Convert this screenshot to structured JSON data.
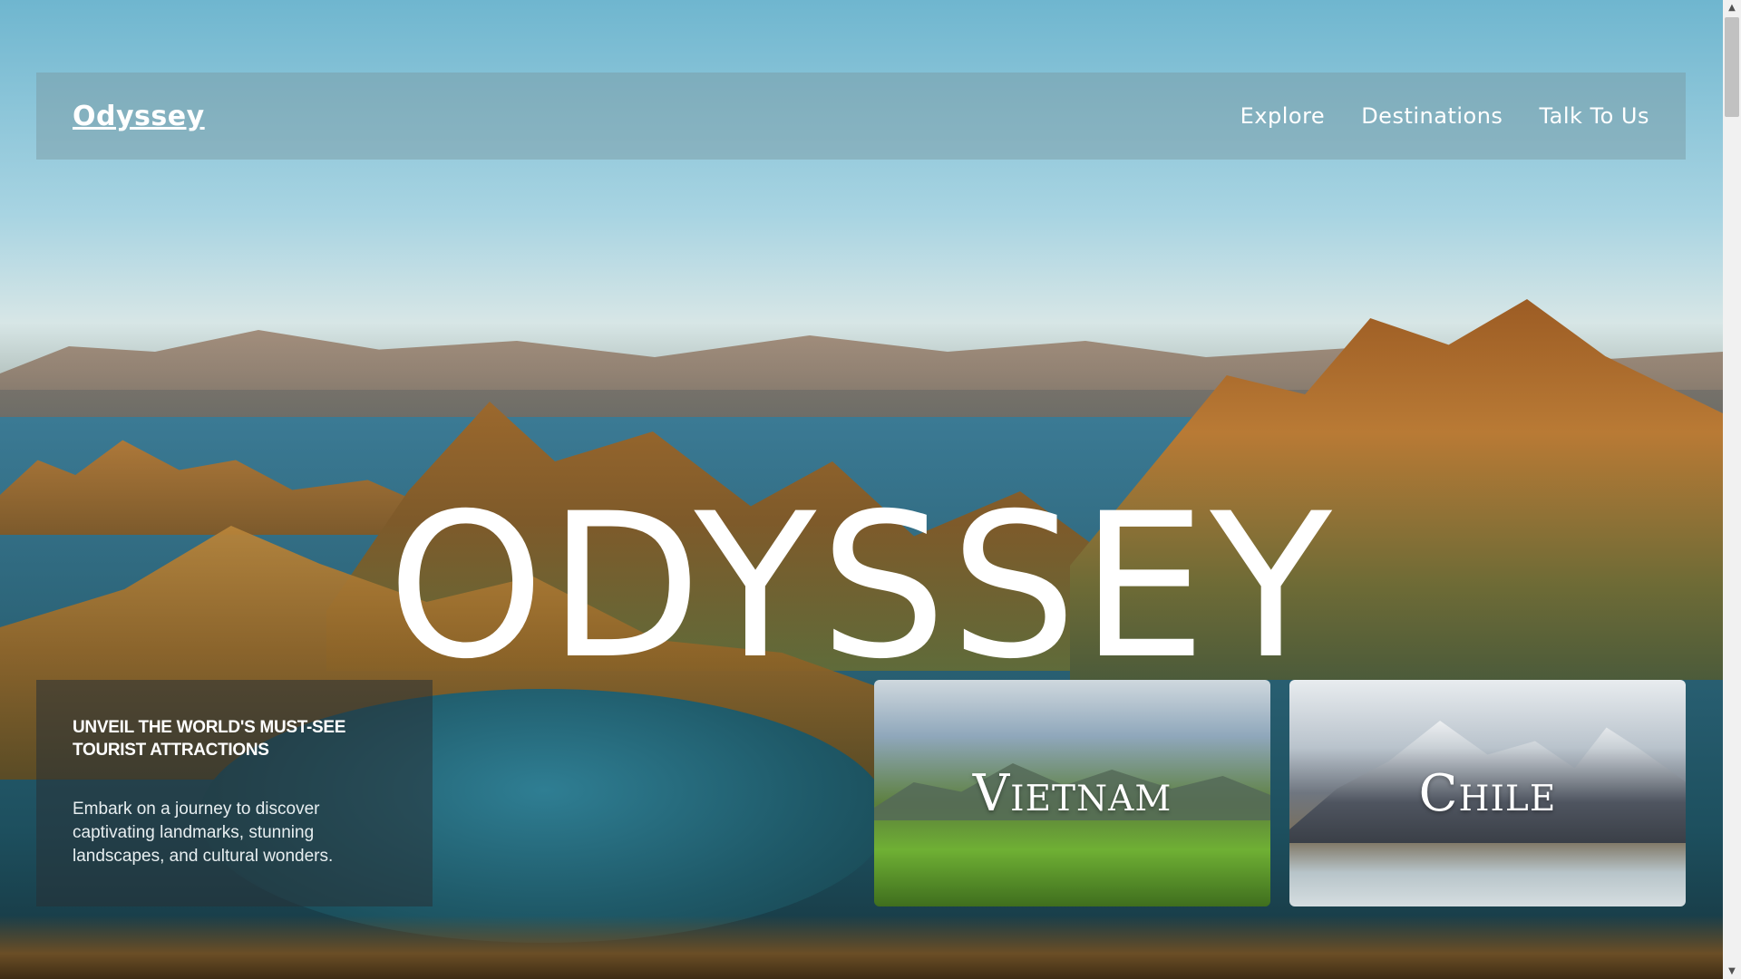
{
  "nav": {
    "brand": "Odyssey",
    "links": [
      "Explore",
      "Destinations",
      "Talk To Us"
    ]
  },
  "hero": {
    "title": "ODYSSEY"
  },
  "info_card": {
    "heading": "Unveil the world's must-see tourist attractions",
    "text": "Embark on a journey to discover captivating landmarks, stunning landscapes, and cultural wonders."
  },
  "destinations": [
    {
      "name": "Vietnam"
    },
    {
      "name": "Chile"
    }
  ],
  "icons": {
    "scroll_up": "triangle-up",
    "scroll_down": "triangle-down"
  }
}
